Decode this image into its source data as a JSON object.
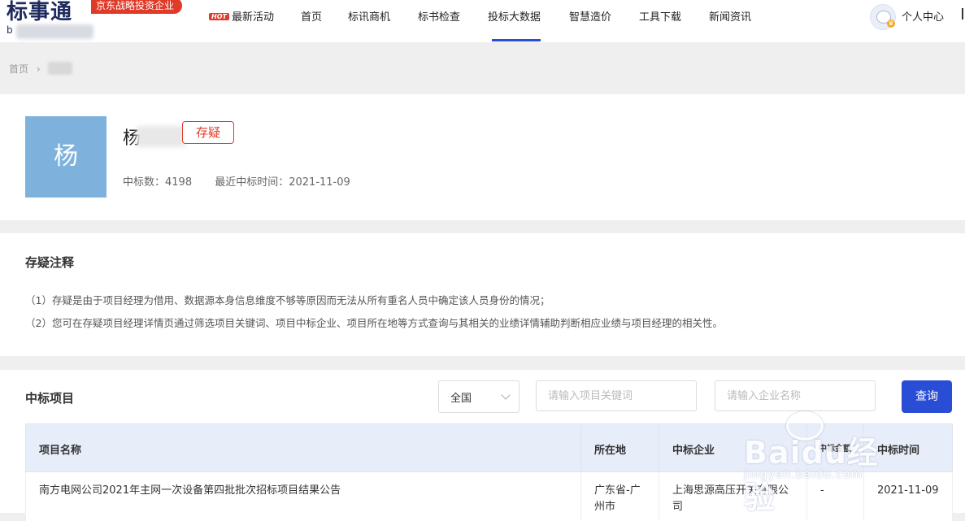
{
  "header": {
    "logo_text": "标事通",
    "logo_sub": "b",
    "logo_badge": "京东战略投资企业",
    "nav": [
      {
        "label": "最新活动",
        "hot": "HOT"
      },
      {
        "label": "首页"
      },
      {
        "label": "标讯商机"
      },
      {
        "label": "标书检查"
      },
      {
        "label": "投标大数据",
        "active": true
      },
      {
        "label": "智慧造价"
      },
      {
        "label": "工具下载"
      },
      {
        "label": "新闻资讯"
      }
    ],
    "user_label": "个人中心"
  },
  "breadcrumb": {
    "home": "首页",
    "sep": "›"
  },
  "profile": {
    "avatar_char": "杨",
    "name_visible": "杨",
    "status_tag": "存疑",
    "award_count": "中标数：4198",
    "last_award": "最近中标时间：2021-11-09"
  },
  "notes": {
    "title": "存疑注释",
    "lines": [
      "（1）存疑是由于项目经理为借用、数据源本身信息维度不够等原因而无法从所有重名人员中确定该人员身份的情况；",
      "（2）您可在存疑项目经理详情页通过筛选项目关键词、项目中标企业、项目所在地等方式查询与其相关的业绩详情辅助判断相应业绩与项目经理的相关性。"
    ]
  },
  "projects": {
    "title": "中标项目",
    "region_select": "全国",
    "keyword_placeholder": "请输入项目关键词",
    "company_placeholder": "请输入企业名称",
    "query_button": "查询",
    "columns": [
      "项目名称",
      "所在地",
      "中标企业",
      "中标金额",
      "中标时间"
    ],
    "rows": [
      {
        "name": "南方电网公司2021年主网一次设备第四批批次招标项目结果公告",
        "location": "广东省-广州市",
        "company": "上海思源高压开关有限公司",
        "amount": "-",
        "date": "2021-11-09"
      }
    ]
  },
  "watermark": {
    "text": "Baidu经验",
    "url": "jingyan.baidu.com"
  }
}
